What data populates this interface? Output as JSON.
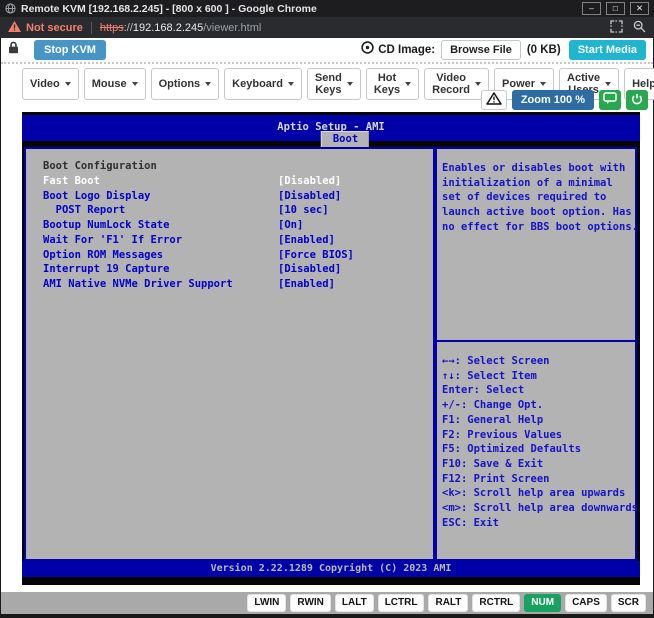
{
  "window": {
    "title": "Remote KVM [192.168.2.245] - [800 x 600 ] - Google Chrome",
    "controls": {
      "minimize": "–",
      "maximize": "□",
      "close": "✕"
    }
  },
  "urlbar": {
    "security_label": "Not secure",
    "protocol": "https",
    "scheme_separator": "://",
    "host": "192.168.2.245",
    "path": "/viewer.html"
  },
  "toolbar": {
    "stop_kvm": "Stop KVM",
    "cd_image_label": "CD Image:",
    "browse_file": "Browse File",
    "cd_size": "(0 KB)",
    "start_media": "Start Media"
  },
  "menubar": {
    "items": [
      "Video",
      "Mouse",
      "Options",
      "Keyboard",
      "Send Keys",
      "Hot Keys",
      "Video Record",
      "Power",
      "Active Users",
      "Help"
    ]
  },
  "controls_row": {
    "zoom": "Zoom 100 %"
  },
  "bios": {
    "title": "Aptio Setup - AMI",
    "tab": "Boot",
    "section": "Boot Configuration",
    "selected_index": 0,
    "items": [
      {
        "label": "Fast Boot",
        "value": "[Disabled]"
      },
      {
        "label": "Boot Logo Display",
        "value": "[Disabled]"
      },
      {
        "label": "  POST Report",
        "value": "[10 sec]"
      },
      {
        "label": "Bootup NumLock State",
        "value": "[On]"
      },
      {
        "label": "Wait For 'F1' If Error",
        "value": "[Enabled]"
      },
      {
        "label": "Option ROM Messages",
        "value": "[Force BIOS]"
      },
      {
        "label": "Interrupt 19 Capture",
        "value": "[Disabled]"
      },
      {
        "label": "AMI Native NVMe Driver Support",
        "value": "[Enabled]"
      }
    ],
    "help_lines": [
      "Enables or disables boot with",
      "initialization of a minimal",
      "set of devices required to",
      "launch active boot option. Has",
      "no effect for BBS boot options."
    ],
    "key_help": [
      "←→: Select Screen",
      "↑↓: Select Item",
      "Enter: Select",
      "+/-: Change Opt.",
      "F1: General Help",
      "F2: Previous Values",
      "F5: Optimized Defaults",
      "F10: Save & Exit",
      "F12: Print Screen",
      "<k>: Scroll help area upwards",
      "<m>: Scroll help area downwards",
      "ESC: Exit"
    ],
    "version": "Version 2.22.1289 Copyright (C) 2023 AMI"
  },
  "statusbar": {
    "keys": [
      "LWIN",
      "RWIN",
      "LALT",
      "LCTRL",
      "RALT",
      "RCTRL",
      "NUM",
      "CAPS",
      "SCR"
    ],
    "active_key": "NUM"
  },
  "colors": {
    "bios_blue": "#0000a8",
    "bios_text_blue": "#0000cc",
    "bios_gray": "#b3b3b3",
    "stop_button_blue": "#4795c6",
    "zoom_button_blue": "#2e6da4",
    "start_media_teal": "#1fb5d1",
    "green_button": "#2aa84f",
    "num_key_green": "#17a35f",
    "warning_red": "#f0806c"
  }
}
